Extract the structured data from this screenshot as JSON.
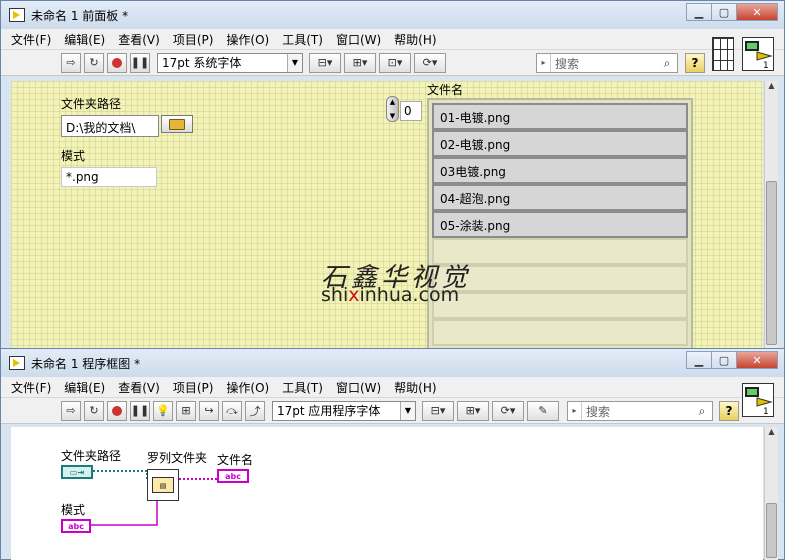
{
  "front_panel": {
    "title": "未命名 1 前面板 *",
    "menu": [
      "文件(F)",
      "编辑(E)",
      "查看(V)",
      "项目(P)",
      "操作(O)",
      "工具(T)",
      "窗口(W)",
      "帮助(H)"
    ],
    "font_select": "17pt 系统字体",
    "search_placeholder": "搜索",
    "folder_path_label": "文件夹路径",
    "folder_path_value": "D:\\我的文档\\",
    "pattern_label": "模式",
    "pattern_value": "*.png",
    "array_label": "文件名",
    "array_index": "0",
    "files": [
      "01-电镀.png",
      "02-电镀.png",
      "03电镀.png",
      "04-超泡.png",
      "05-涂装.png"
    ],
    "empty_rows": 4
  },
  "block_diagram": {
    "title": "未命名 1 程序框图 *",
    "menu": [
      "文件(F)",
      "编辑(E)",
      "查看(V)",
      "项目(P)",
      "操作(O)",
      "工具(T)",
      "窗口(W)",
      "帮助(H)"
    ],
    "font_select": "17pt 应用程序字体",
    "search_placeholder": "搜索",
    "folder_path_label": "文件夹路径",
    "list_folder_label": "罗列文件夹",
    "file_names_label": "文件名",
    "pattern_label": "模式",
    "string_terminal": "abc"
  },
  "watermark": {
    "cn": "石鑫华视觉",
    "en_prefix": "shi",
    "en_red": "x",
    "en_suffix": "inhua.com"
  },
  "colors": {
    "panel": "#f3f3b8",
    "path_wire": "#1b7a7a",
    "string_wire": "#cc00cc"
  }
}
